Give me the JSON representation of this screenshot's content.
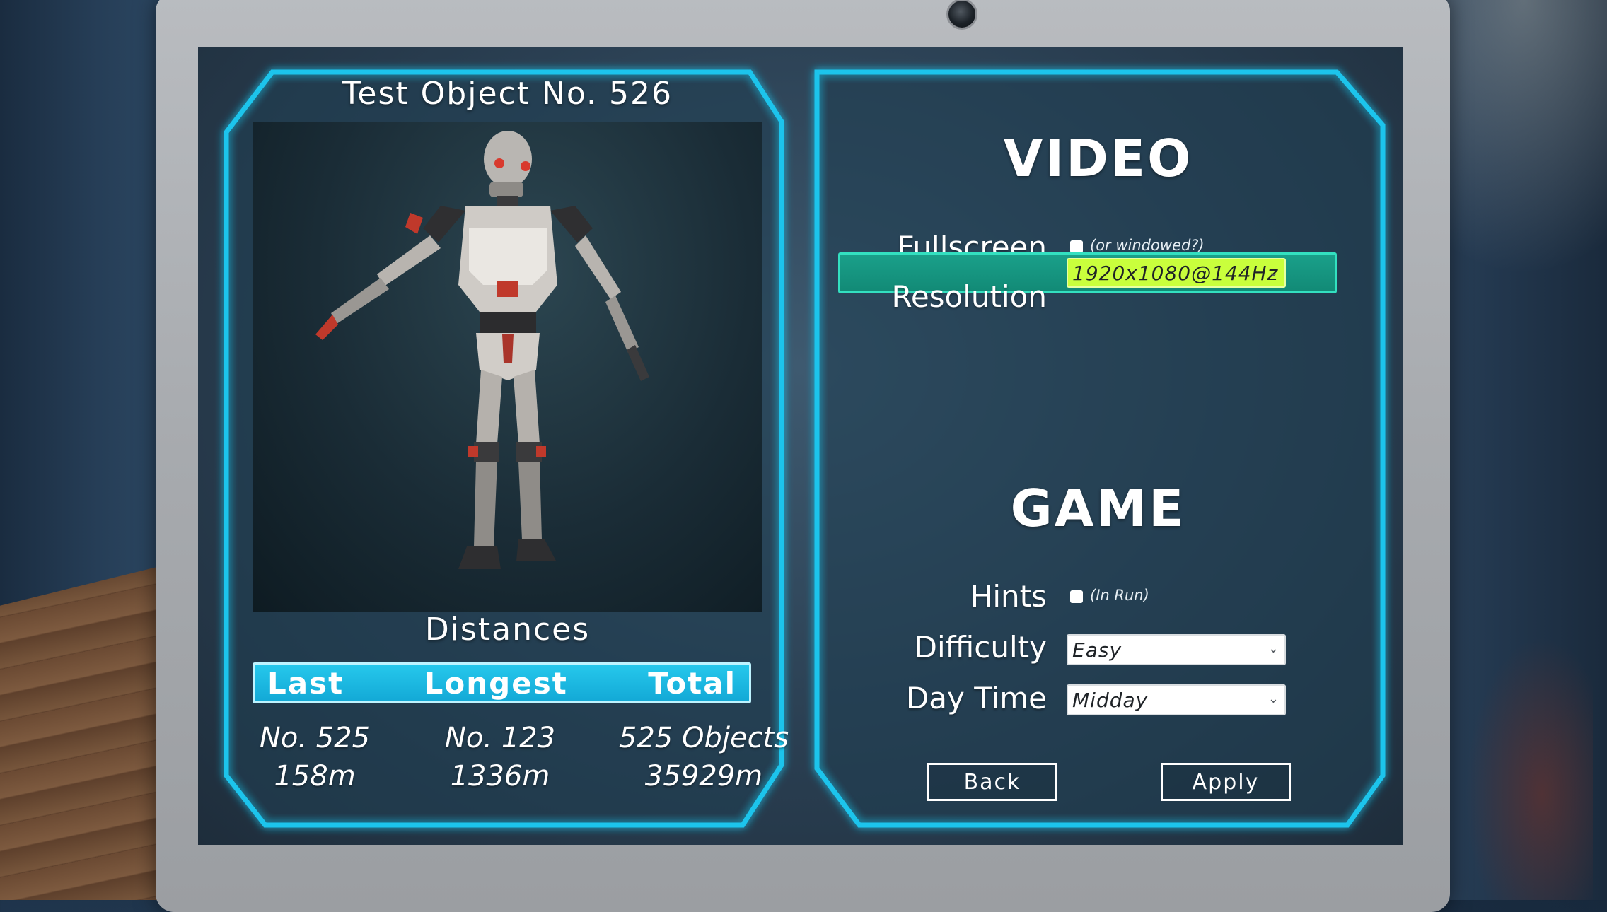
{
  "left_panel": {
    "object_title": "Test Object No. 526",
    "distances_title": "Distances",
    "columns": [
      {
        "header": "Last",
        "line1": "No. 525",
        "line2": "158m"
      },
      {
        "header": "Longest",
        "line1": "No. 123",
        "line2": "1336m"
      },
      {
        "header": "Total",
        "line1": "525 Objects",
        "line2": "35929m"
      }
    ]
  },
  "video": {
    "heading": "VIDEO",
    "fullscreen_label": "Fullscreen",
    "fullscreen_hint": "(or windowed?)",
    "fullscreen_checked": false,
    "resolution_label": "Resolution",
    "resolution_value": "1920x1080@144Hz"
  },
  "game": {
    "heading": "GAME",
    "hints_label": "Hints",
    "hints_hint": "(In Run)",
    "hints_checked": false,
    "difficulty_label": "Difficulty",
    "difficulty_value": "Easy",
    "daytime_label": "Day Time",
    "daytime_value": "Midday"
  },
  "buttons": {
    "back": "Back",
    "apply": "Apply"
  },
  "icons": {
    "dropdown_chevron": "chevron-down-icon",
    "checkbox": "checkbox-icon"
  },
  "colors": {
    "frame_cyan": "#1fc4ec",
    "resolution_highlight": "#128a76",
    "resolution_dropdown": "#c9ff3c",
    "distance_bar": "#13a9d6"
  }
}
